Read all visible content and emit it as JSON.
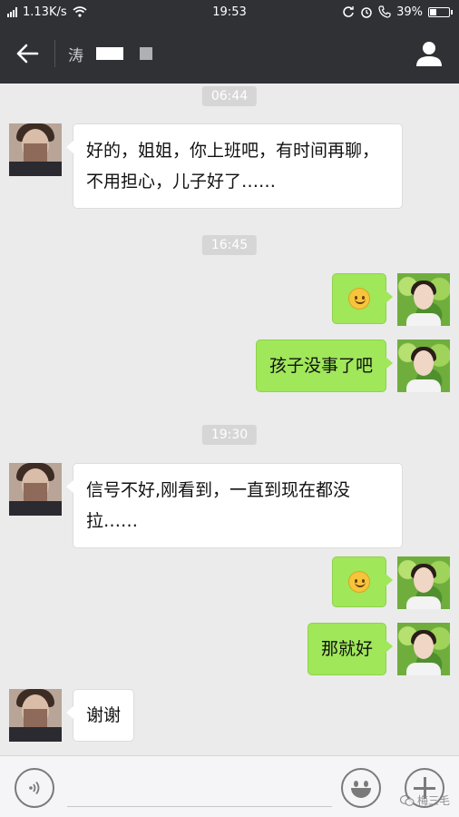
{
  "status_bar": {
    "net_speed": "1.13K/s",
    "time": "19:53",
    "battery": "39%",
    "battery_level": 0.39
  },
  "header": {
    "title_glyph": "涛"
  },
  "messages": [
    {
      "type": "time",
      "text": "06:44"
    },
    {
      "type": "in",
      "text": "好的，姐姐，你上班吧，有时间再聊，不用担心，儿子好了……"
    },
    {
      "type": "time",
      "text": "16:45"
    },
    {
      "type": "out-emoji",
      "emoji": "smile-emoji"
    },
    {
      "type": "out",
      "text": "孩子没事了吧"
    },
    {
      "type": "time",
      "text": "19:30"
    },
    {
      "type": "in",
      "text": "信号不好,刚看到，一直到现在都没拉……"
    },
    {
      "type": "out-emoji",
      "emoji": "smile-emoji"
    },
    {
      "type": "out",
      "text": "那就好"
    },
    {
      "type": "in",
      "text": "谢谢"
    }
  ],
  "input_bar": {
    "placeholder": "",
    "watermark": "梅三毛"
  },
  "colors": {
    "header_bg": "#2f3135",
    "chat_bg": "#ebebeb",
    "outgoing_bubble": "#a0e75a",
    "incoming_bubble": "#ffffff"
  }
}
